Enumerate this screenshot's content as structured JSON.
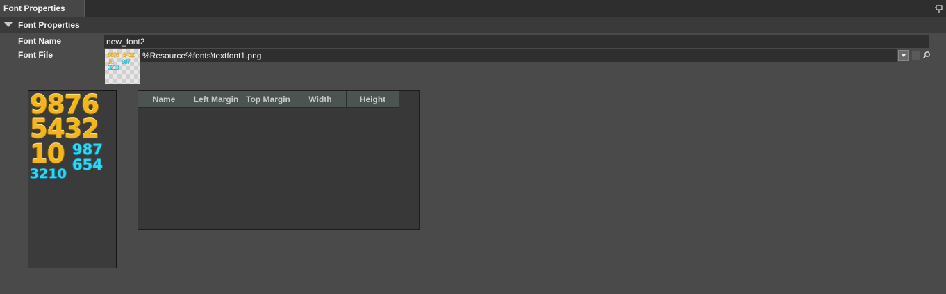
{
  "tab": {
    "title": "Font Properties"
  },
  "section": {
    "title": "Font Properties"
  },
  "font_name": {
    "label": "Font Name",
    "value": "new_font2"
  },
  "font_file": {
    "label": "Font File",
    "value": "%Resource%fonts\\textfont1.png",
    "dots": "..."
  },
  "preview": {
    "rows": [
      {
        "text": "9876",
        "color": "gold"
      },
      {
        "text": "5432",
        "color": "gold"
      },
      {
        "text": "10",
        "color": "gold"
      },
      {
        "text": "987",
        "color": "cyan"
      },
      {
        "text": "654",
        "color": "cyan"
      },
      {
        "text": "3210",
        "color": "cyan"
      }
    ]
  },
  "table": {
    "columns": [
      "Name",
      "Left Margin",
      "Top Margin",
      "Width",
      "Height"
    ],
    "rows": []
  },
  "colors": {
    "background": "#4a4a4a",
    "header": "#4b5451",
    "gold": "#f2b61e",
    "cyan": "#33d6ee"
  }
}
